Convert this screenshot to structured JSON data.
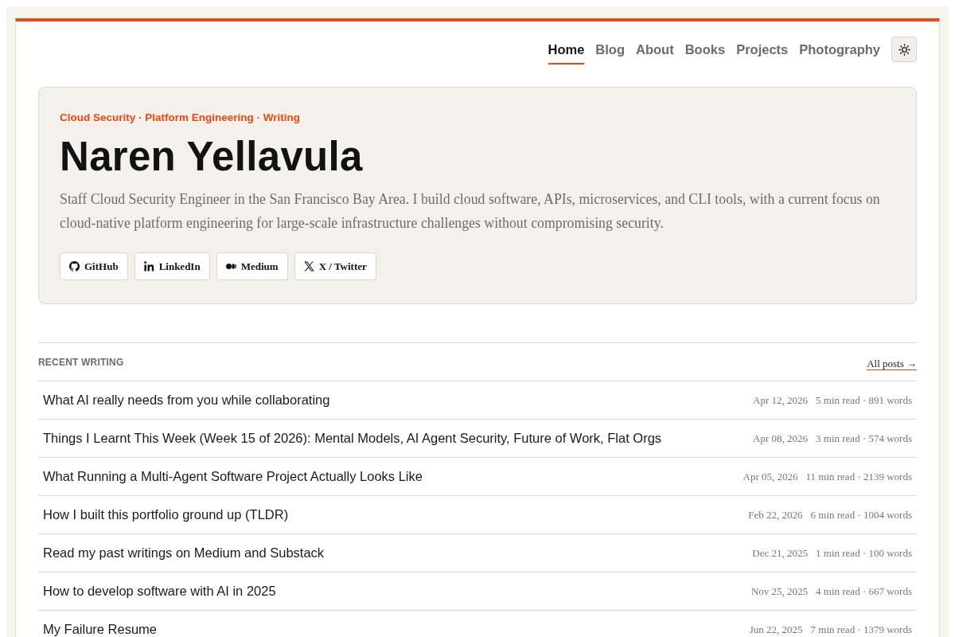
{
  "nav": {
    "items": [
      {
        "label": "Home",
        "selected": true
      },
      {
        "label": "Blog",
        "selected": false
      },
      {
        "label": "About",
        "selected": false
      },
      {
        "label": "Books",
        "selected": false
      },
      {
        "label": "Projects",
        "selected": false
      },
      {
        "label": "Photography",
        "selected": false
      }
    ]
  },
  "hero": {
    "tagline": "Cloud Security · Platform Engineering · Writing",
    "name": "Naren Yellavula",
    "description": "Staff Cloud Security Engineer in the San Francisco Bay Area. I build cloud software, APIs, microservices, and CLI tools, with a current focus on cloud-native platform engineering for large-scale infrastructure challenges without compromising security.",
    "links": [
      {
        "label": "GitHub",
        "kind": "github"
      },
      {
        "label": "LinkedIn",
        "kind": "linkedin"
      },
      {
        "label": "Medium",
        "kind": "medium"
      },
      {
        "label": "X / Twitter",
        "kind": "x"
      }
    ]
  },
  "recent_writing": {
    "heading": "RECENT WRITING",
    "all_posts_link": "All posts →",
    "posts": [
      {
        "title": "What AI really needs from you while collaborating",
        "date": "Apr 12, 2026",
        "stats": "5 min read · 891 words"
      },
      {
        "title": "Things I Learnt This Week (Week 15 of 2026): Mental Models, AI Agent Security, Future of Work, Flat Orgs",
        "date": "Apr 08, 2026",
        "stats": "3 min read · 574 words"
      },
      {
        "title": "What Running a Multi-Agent Software Project Actually Looks Like",
        "date": "Apr 05, 2026",
        "stats": "11 min read · 2139 words"
      },
      {
        "title": "How I built this portfolio ground up (TLDR)",
        "date": "Feb 22, 2026",
        "stats": "6 min read · 1004 words"
      },
      {
        "title": "Read my past writings on Medium and Substack",
        "date": "Dec 21, 2025",
        "stats": "1 min read · 100 words"
      },
      {
        "title": "How to develop software with AI in 2025",
        "date": "Nov 25, 2025",
        "stats": "4 min read · 667 words"
      },
      {
        "title": "My Failure Resume",
        "date": "Jun 22, 2025",
        "stats": "7 min read · 1379 words"
      }
    ]
  }
}
